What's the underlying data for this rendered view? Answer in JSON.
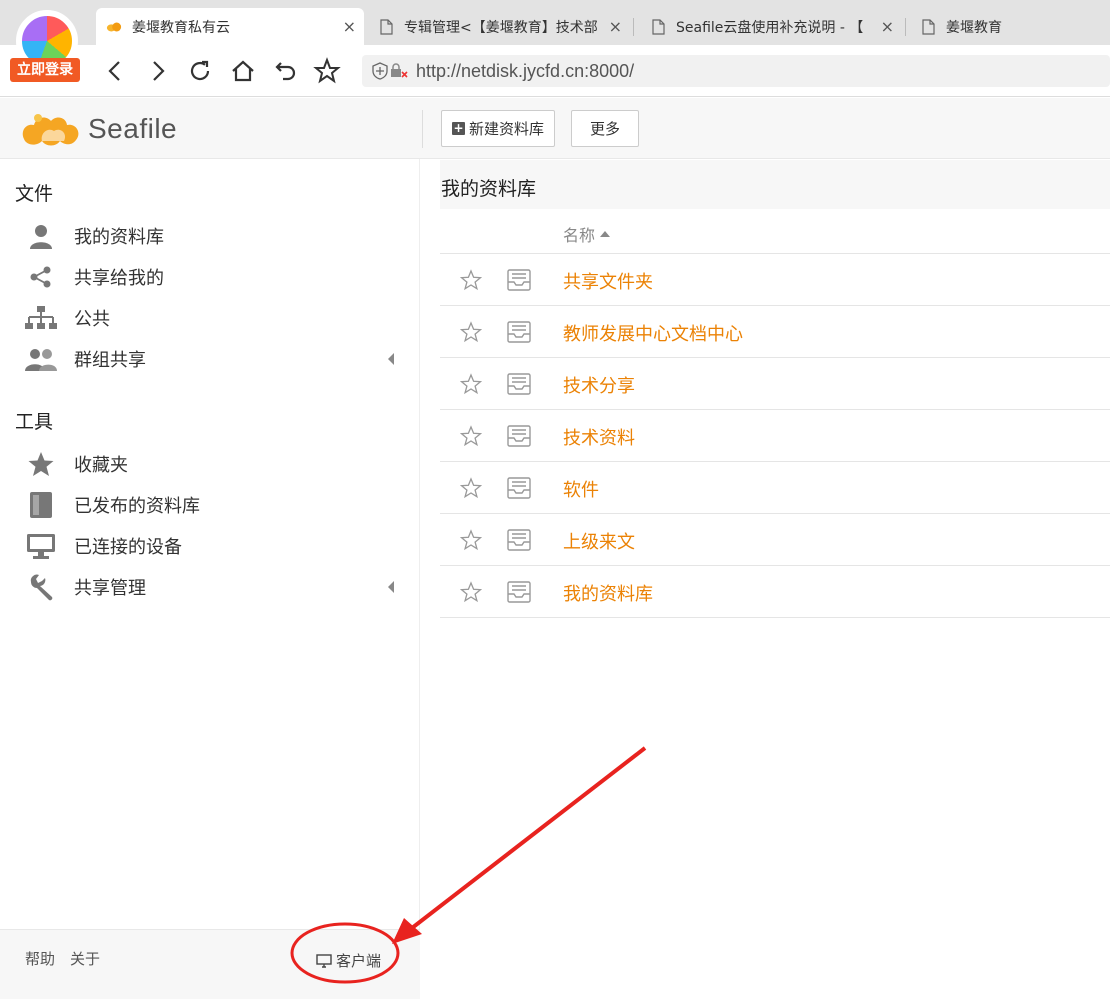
{
  "browser": {
    "login_badge": "立即登录",
    "tabs": [
      {
        "title": "姜堰教育私有云",
        "active": true
      },
      {
        "title": "专辑管理<【姜堰教育】技术部",
        "active": false
      },
      {
        "title": "Seafile云盘使用补充说明 - 【",
        "active": false
      },
      {
        "title": "姜堰教育",
        "active": false
      }
    ],
    "close_glyph": "×",
    "url": "http://netdisk.jycfd.cn:8000/"
  },
  "header": {
    "logo_text": "Seafile",
    "new_library_label": "新建资料库",
    "more_label": "更多"
  },
  "sidebar": {
    "files_title": "文件",
    "files_items": [
      {
        "label": "我的资料库",
        "icon": "user-icon"
      },
      {
        "label": "共享给我的",
        "icon": "share-icon"
      },
      {
        "label": "公共",
        "icon": "org-chart-icon"
      },
      {
        "label": "群组共享",
        "icon": "group-icon"
      }
    ],
    "tools_title": "工具",
    "tools_items": [
      {
        "label": "收藏夹",
        "icon": "star-icon"
      },
      {
        "label": "已发布的资料库",
        "icon": "book-icon"
      },
      {
        "label": "已连接的设备",
        "icon": "monitor-icon"
      },
      {
        "label": "共享管理",
        "icon": "wrench-icon"
      }
    ],
    "footer": {
      "help": "帮助",
      "about": "关于",
      "client": "客户端"
    }
  },
  "main": {
    "title": "我的资料库",
    "column_name": "名称",
    "libraries": [
      {
        "name": "共享文件夹"
      },
      {
        "name": "教师发展中心文档中心"
      },
      {
        "name": "技术分享"
      },
      {
        "name": "技术资料"
      },
      {
        "name": "软件"
      },
      {
        "name": "上级来文"
      },
      {
        "name": "我的资料库"
      }
    ]
  },
  "colors": {
    "accent_orange": "#eb8205",
    "annotation_red": "#e8231f"
  }
}
